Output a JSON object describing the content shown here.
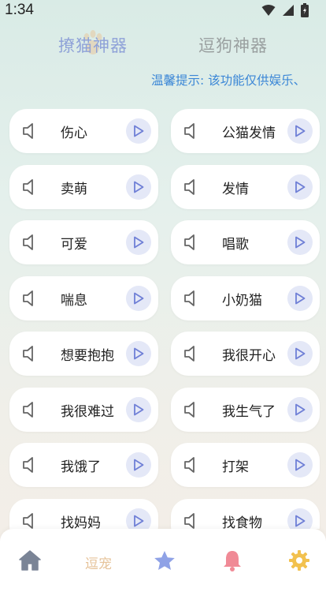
{
  "status_bar": {
    "time": "1:34"
  },
  "header": {
    "tabs": [
      {
        "label": "撩猫神器",
        "active": true
      },
      {
        "label": "逗狗神器",
        "active": false
      }
    ],
    "tip": "温馨提示: 该功能仅供娱乐、"
  },
  "sounds": [
    {
      "left": "伤心",
      "right": "公猫发情"
    },
    {
      "left": "卖萌",
      "right": "发情"
    },
    {
      "left": "可爱",
      "right": "唱歌"
    },
    {
      "left": "喘息",
      "right": "小奶猫"
    },
    {
      "left": "想要抱抱",
      "right": "我很开心"
    },
    {
      "left": "我很难过",
      "right": "我生气了"
    },
    {
      "left": "我饿了",
      "right": "打架"
    },
    {
      "left": "找妈妈",
      "right": "找食物"
    }
  ],
  "bottom_nav": {
    "items": [
      {
        "icon": "home-icon",
        "color": "#7a8496"
      },
      {
        "label": "逗宠",
        "color": "#e6c39a"
      },
      {
        "icon": "star-icon",
        "color": "#8fa2e6"
      },
      {
        "icon": "bell-icon",
        "color": "#f08a96"
      },
      {
        "icon": "gear-icon",
        "color": "#f2c14e"
      }
    ]
  },
  "colors": {
    "accent": "#6f7fd6",
    "play_bg": "#e4e8f7",
    "tip": "#3a86d6"
  }
}
